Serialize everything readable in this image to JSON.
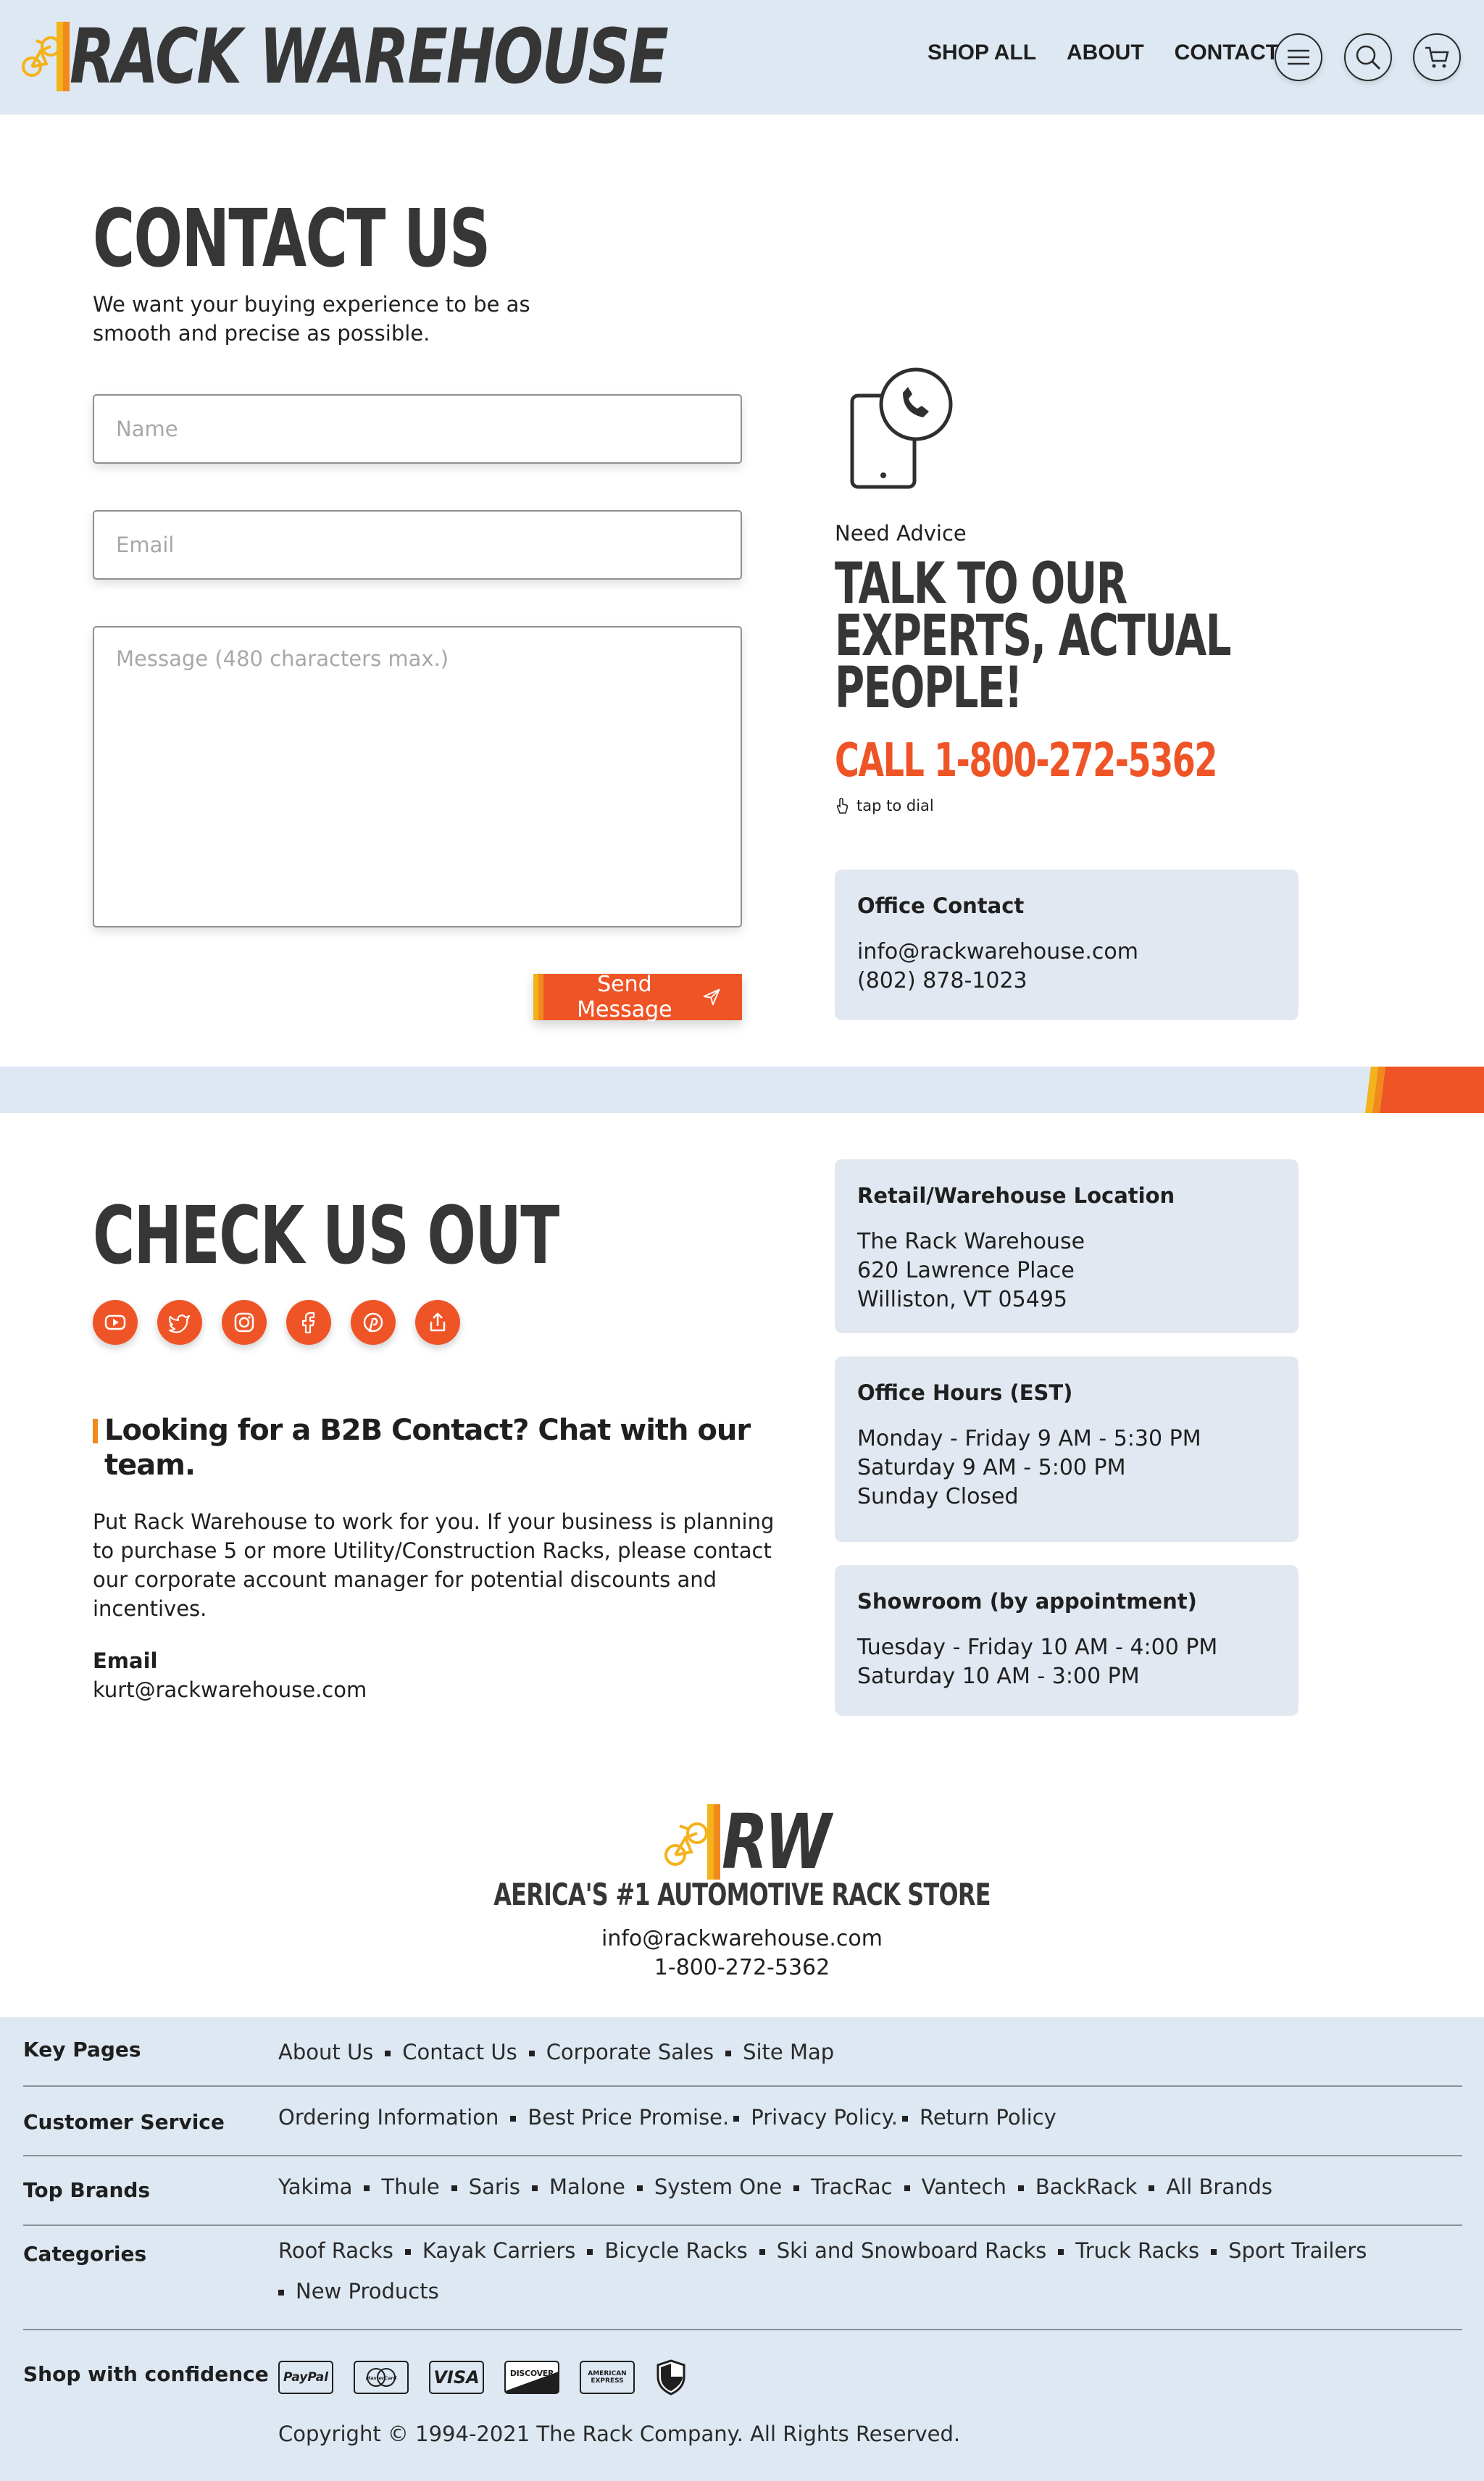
{
  "header": {
    "logo_text": "RACK WAREHOUSE",
    "nav": [
      "SHOP ALL",
      "ABOUT",
      "CONTACT"
    ],
    "icons": [
      "menu-icon",
      "search-icon",
      "cart-icon"
    ]
  },
  "contact": {
    "title": "CONTACT US",
    "intro_line1": "We want your buying experience to be as",
    "intro_line2": "smooth and precise as possible.",
    "name_placeholder": "Name",
    "email_placeholder": "Email",
    "message_placeholder": "Message (480 characters max.)",
    "send_label": "Send Message"
  },
  "advice": {
    "eyebrow": "Need Advice",
    "headline_line1": "TALK TO OUR",
    "headline_line2": "EXPERTS, ACTUAL",
    "headline_line3": "PEOPLE!",
    "call_text": "CALL 1-800-272-5362",
    "tap_text": "tap to dial"
  },
  "office_contact": {
    "title": "Office Contact",
    "email": "info@rackwarehouse.com",
    "phone": "(802) 878-1023"
  },
  "check_us_out": {
    "title": "CHECK US OUT",
    "social_icons": [
      "youtube-icon",
      "twitter-icon",
      "instagram-icon",
      "facebook-icon",
      "pinterest-icon",
      "share-icon"
    ]
  },
  "b2b": {
    "heading_line1": "Looking for a  B2B Contact? Chat with our",
    "heading_line2": "team.",
    "para_line1": "Put Rack Warehouse to work for you. If your business is planning",
    "para_line2": "to purchase 5 or more Utility/Construction Racks, please contact",
    "para_line3": "our corporate account manager for potential discounts and",
    "para_line4": "incentives.",
    "email_label": "Email",
    "email": "kurt@rackwarehouse.com"
  },
  "location": {
    "title": "Retail/Warehouse Location",
    "line1": "The Rack Warehouse",
    "line2": "620 Lawrence Place",
    "line3": "Williston, VT 05495"
  },
  "hours": {
    "title": "Office Hours (EST)",
    "line1": "Monday - Friday 9 AM - 5:30 PM",
    "line2": "Saturday 9 AM - 5:00 PM",
    "line3": "Sunday Closed"
  },
  "showroom": {
    "title": "Showroom (by appointment)",
    "line1": "Tuesday - Friday 10 AM - 4:00 PM",
    "line2": "Saturday 10 AM - 3:00 PM"
  },
  "brand_block": {
    "logo_text": "RW",
    "tagline": "AERICA'S #1 AUTOMOTIVE RACK STORE",
    "email": "info@rackwarehouse.com",
    "phone": "1-800-272-5362"
  },
  "footer": {
    "rows": [
      {
        "label": "Key Pages",
        "links": [
          "About Us",
          "Contact Us",
          "Corporate Sales",
          "Site Map"
        ]
      },
      {
        "label": "Customer Service",
        "links": [
          "Ordering Information",
          "Best Price Promise.",
          "Privacy Policy.",
          "Return Policy"
        ]
      },
      {
        "label": "Top Brands",
        "links": [
          "Yakima",
          "Thule",
          "Saris",
          "Malone",
          "System One",
          "TracRac",
          "Vantech",
          "BackRack",
          "All Brands"
        ]
      },
      {
        "label": "Categories",
        "links": [
          "Roof Racks",
          "Kayak Carriers",
          "Bicycle Racks",
          "Ski and Snowboard Racks",
          "Truck Racks",
          "Sport Trailers",
          "New Products"
        ]
      }
    ],
    "confidence_label": "Shop with confidence",
    "payment_marks": [
      "PayPal",
      "MasterCard",
      "VISA",
      "DISCOVER",
      "AMERICAN EXPRESS"
    ],
    "copyright": "Copyright © 1994-2021 The Rack Company. All Rights Reserved."
  },
  "colors": {
    "accent": "#ef5426",
    "accent_yellow": "#f4b21b",
    "band": "#dde8f2",
    "card": "#e2e8f1",
    "heading": "#363636"
  }
}
